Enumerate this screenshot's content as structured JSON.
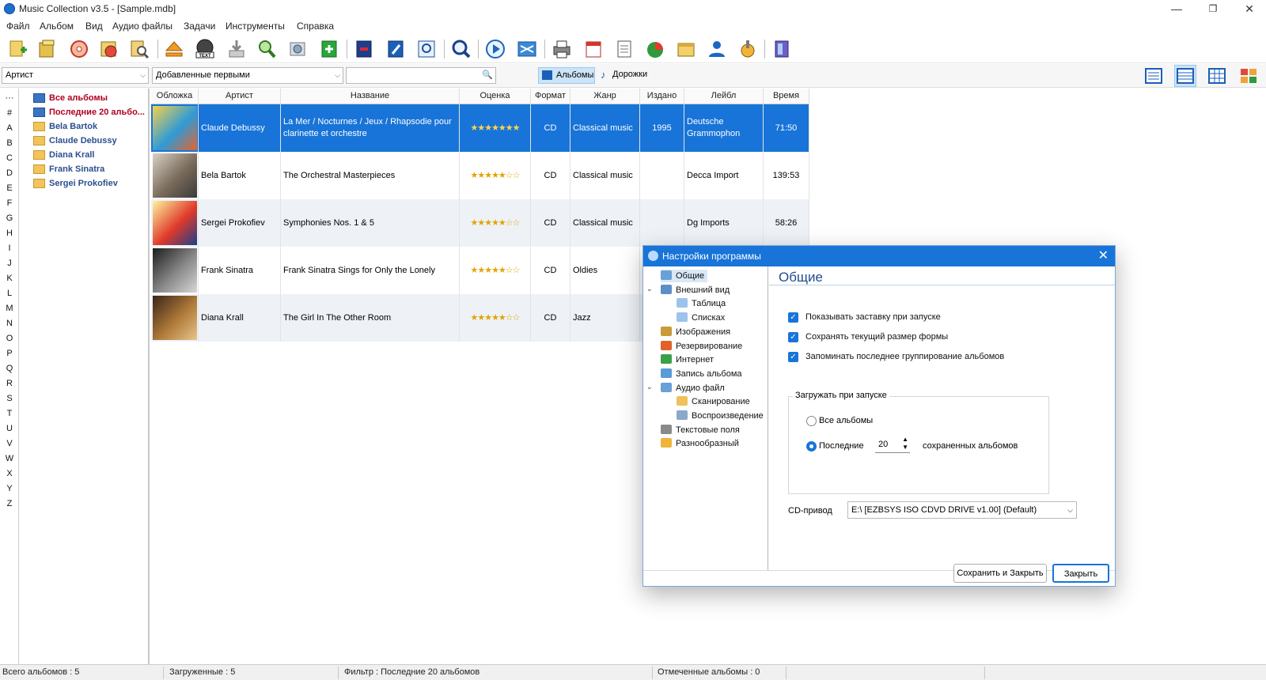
{
  "window": {
    "title": "Music Collection v3.5 - [Sample.mdb]",
    "minimize": "—",
    "restore": "❐",
    "close": "✕"
  },
  "menu": [
    "Файл",
    "Альбом",
    "Вид",
    "Аудио файлы",
    "Задачи",
    "Инструменты",
    "Справка"
  ],
  "filterbar": {
    "field_combo": "Артист",
    "sort_combo": "Добавленные первыми",
    "search_value": "",
    "albums_button": "Альбомы",
    "tracks_button": "Дорожки"
  },
  "alphabet": [
    "···",
    "#",
    "A",
    "B",
    "C",
    "D",
    "E",
    "F",
    "G",
    "H",
    "I",
    "J",
    "K",
    "L",
    "M",
    "N",
    "O",
    "P",
    "Q",
    "R",
    "S",
    "T",
    "U",
    "V",
    "W",
    "X",
    "Y",
    "Z"
  ],
  "tree": [
    {
      "label": "Все альбомы",
      "style": "red",
      "icon": "blue"
    },
    {
      "label": "Последние 20 альбо...",
      "style": "red",
      "icon": "blue"
    },
    {
      "label": "Bela Bartok",
      "style": "blue",
      "icon": "yellow"
    },
    {
      "label": "Claude Debussy",
      "style": "blue",
      "icon": "yellow"
    },
    {
      "label": "Diana Krall",
      "style": "blue",
      "icon": "yellow"
    },
    {
      "label": "Frank Sinatra",
      "style": "blue",
      "icon": "yellow"
    },
    {
      "label": "Sergei Prokofiev",
      "style": "blue",
      "icon": "yellow"
    }
  ],
  "grid": {
    "columns": [
      "Обложка",
      "Артист",
      "Название",
      "Оценка",
      "Формат",
      "Жанр",
      "Издано",
      "Лейбл",
      "Время"
    ],
    "rows": [
      {
        "artist": "Claude Debussy",
        "title": "La Mer / Nocturnes / Jeux / Rhapsodie pour clarinette et orchestre",
        "rating": "★★★★★★★",
        "format": "CD",
        "genre": "Classical music",
        "year": "1995",
        "label": "Deutsche Grammophon",
        "time": "71:50",
        "selected": true
      },
      {
        "artist": "Bela Bartok",
        "title": "The Orchestral Masterpieces",
        "rating": "★★★★★☆☆",
        "format": "CD",
        "genre": "Classical music",
        "year": "",
        "label": "Decca Import",
        "time": "139:53",
        "selected": false
      },
      {
        "artist": "Sergei Prokofiev",
        "title": "Symphonies Nos. 1 & 5",
        "rating": "★★★★★☆☆",
        "format": "CD",
        "genre": "Classical music",
        "year": "",
        "label": "Dg Imports",
        "time": "58:26",
        "selected": false
      },
      {
        "artist": "Frank Sinatra",
        "title": "Frank Sinatra Sings for Only the Lonely",
        "rating": "★★★★★☆☆",
        "format": "CD",
        "genre": "Oldies",
        "year": "",
        "label": "",
        "time": "",
        "selected": false
      },
      {
        "artist": "Diana Krall",
        "title": "The Girl In The Other Room",
        "rating": "★★★★★☆☆",
        "format": "CD",
        "genre": "Jazz",
        "year": "",
        "label": "",
        "time": "",
        "selected": false
      }
    ]
  },
  "status": {
    "total": "Всего альбомов : 5",
    "loaded": "Загруженные : 5",
    "filter": "Фильтр : Последние 20 альбомов",
    "marked": "Отмеченные альбомы : 0"
  },
  "dialog": {
    "title": "Настройки программы",
    "heading": "Общие",
    "tree": [
      "Общие",
      "Внешний вид",
      "Таблица",
      "Списках",
      "Изображения",
      "Резервирование",
      "Интернет",
      "Запись альбома",
      "Аудио файл",
      "Сканирование",
      "Воспроизведение",
      "Текстовые поля",
      "Разнообразный"
    ],
    "options": [
      "Показывать заставку при запуске",
      "Сохранять текущий размер формы",
      "Запоминать последнее группирование альбомов"
    ],
    "startup_group": "Загружать при запуске",
    "radio_all": "Все альбомы",
    "radio_last": "Последние",
    "last_count": "20",
    "saved_albums": "сохраненных альбомов",
    "cd_label": "CD-привод",
    "cd_value": "E:\\ [EZBSYS ISO CDVD DRIVE v1.00]  (Default)",
    "save_close": "Сохранить и Закрыть",
    "close": "Закрыть"
  }
}
